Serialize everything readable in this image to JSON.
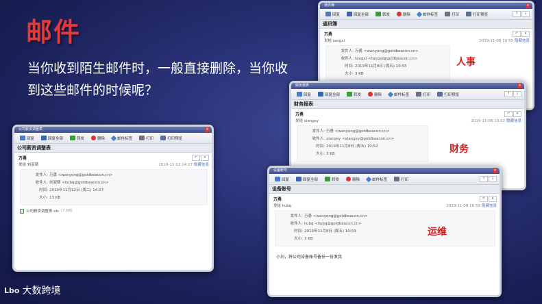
{
  "slide": {
    "title": "邮件",
    "body": "当你收到陌生邮件时，一般直接删除，当你收到这些邮件的时候呢？",
    "brand_mark": "Lbo",
    "brand_name": "大数跨境"
  },
  "toolbar": {
    "reply": "回复",
    "reply_all": "回复全部",
    "forward": "转发",
    "delete": "删除",
    "tag": "邮件标签",
    "print": "打印",
    "print_preview": "打印预览",
    "prev": "↑",
    "next": "↓"
  },
  "labels": {
    "from": "发件人:",
    "to": "收件人:",
    "time": "时间:",
    "size": "大小:",
    "sender_prefix": "发给",
    "details": "隐藏信息"
  },
  "windows": [
    {
      "window_title": "公司薪资调整表",
      "subject": "公司薪资调整表",
      "sender": "万勇",
      "recipient": "刘淑晴",
      "date": "2019-11-12 14:27",
      "from": "万勇 <wanyong@goldbeacon.cn>",
      "to": "刘淑晴 <liubq@goldbeacon.cn>",
      "time": "2019年11月12日 (周二) 14:27",
      "size": "13 KB",
      "attachment": "公司薪资调整表.xls",
      "attachment_size": "(7 KB)"
    },
    {
      "window_title": "通讯簿",
      "subject": "通讯簿",
      "sender": "万勇",
      "recipient": "tangxl",
      "date": "2019-11-08 10:55",
      "from": "万勇 <wanyong@goldbeacon.cn>",
      "to": "tangxl <tangxl@goldbeacon.cn>",
      "time": "2019年11月8日 (周五) 10:55",
      "size": "3 KB",
      "dept": "人事"
    },
    {
      "window_title": "财务报表",
      "subject": "财务报表",
      "sender": "万勇",
      "recipient": "xiangsy",
      "date": "2019-11-08 10:52",
      "from": "万勇 <wanyong@goldbeacon.cn>",
      "to": "xiangsy <xiangsy@goldbeacon.cn>",
      "time": "2019年11月8日 (周五) 10:52",
      "size": "3 KB",
      "dept": "财务"
    },
    {
      "window_title": "设备账号",
      "subject": "设备账号",
      "sender": "万勇",
      "recipient": "liubq",
      "date": "2019-11-08 10:59",
      "from": "万勇 <wanyong@goldbeacon.cn>",
      "to": "liubq <liubq@goldbeacon.cn>",
      "time": "2019年11月8日 (周五) 10:59",
      "size": "3 KB",
      "body": "小刘，将公司设备账号备份一份发我",
      "dept": "运维"
    }
  ]
}
